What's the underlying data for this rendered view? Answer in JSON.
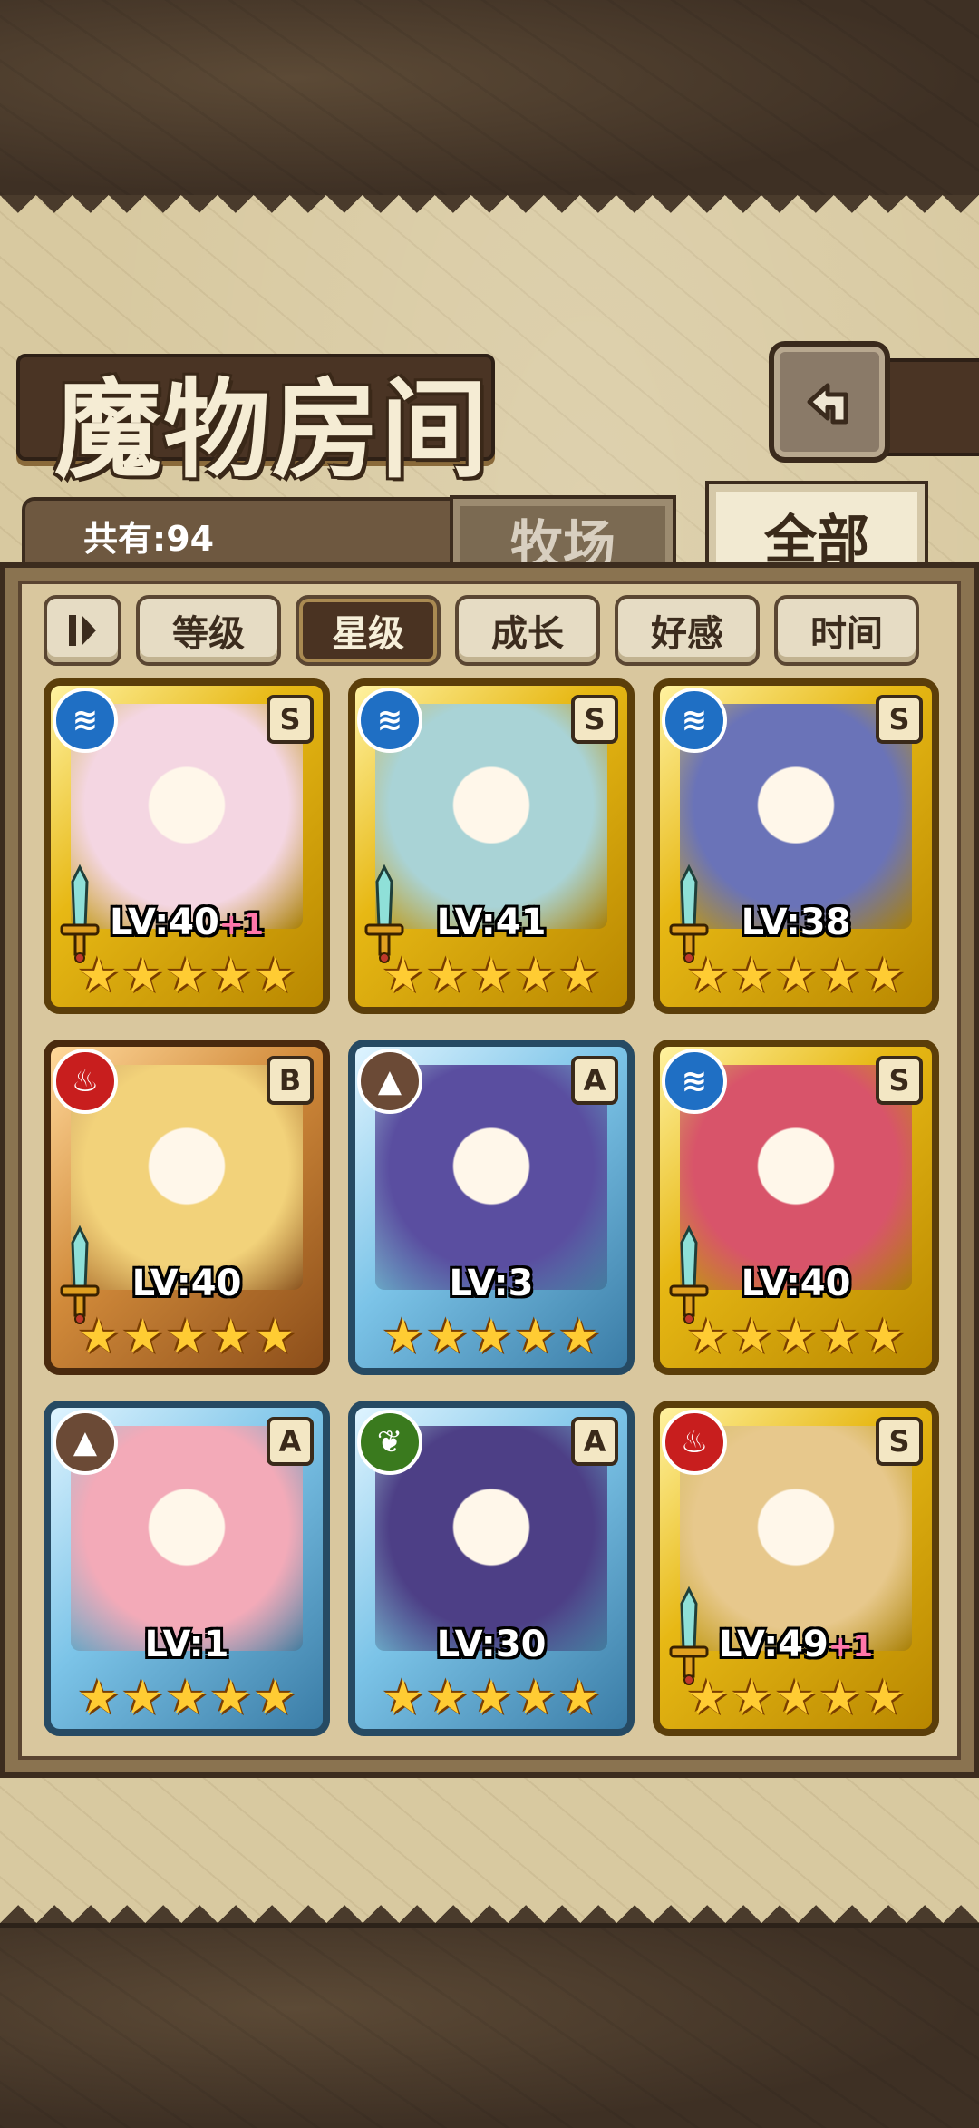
{
  "header": {
    "title": "魔物房间"
  },
  "count": {
    "label": "共有:94"
  },
  "tabs": [
    {
      "label": "牧场",
      "active": false
    },
    {
      "label": "全部",
      "active": true
    }
  ],
  "sort": [
    {
      "label": "等级",
      "active": false
    },
    {
      "label": "星级",
      "active": true
    },
    {
      "label": "成长",
      "active": false
    },
    {
      "label": "好感",
      "active": false
    },
    {
      "label": "时间",
      "active": false
    }
  ],
  "cards": [
    {
      "lv": "LV:40",
      "plus": "+1",
      "rank": "S",
      "element": "water",
      "frame": "gold",
      "stars": 5,
      "sword": true,
      "portrait_color": "#f4d6e2"
    },
    {
      "lv": "LV:41",
      "plus": "",
      "rank": "S",
      "element": "water",
      "frame": "gold",
      "stars": 5,
      "sword": true,
      "portrait_color": "#a9d3d6"
    },
    {
      "lv": "LV:38",
      "plus": "",
      "rank": "S",
      "element": "water",
      "frame": "gold",
      "stars": 5,
      "sword": true,
      "portrait_color": "#6a73b8"
    },
    {
      "lv": "LV:40",
      "plus": "",
      "rank": "B",
      "element": "fire",
      "frame": "bronze",
      "stars": 5,
      "sword": true,
      "portrait_color": "#f2d27a"
    },
    {
      "lv": "LV:3",
      "plus": "",
      "rank": "A",
      "element": "earth",
      "frame": "blue",
      "stars": 5,
      "sword": false,
      "portrait_color": "#5a4ea0"
    },
    {
      "lv": "LV:40",
      "plus": "",
      "rank": "S",
      "element": "water",
      "frame": "gold",
      "stars": 5,
      "sword": true,
      "portrait_color": "#d8546a"
    },
    {
      "lv": "LV:1",
      "plus": "",
      "rank": "A",
      "element": "earth",
      "frame": "blue",
      "stars": 5,
      "sword": false,
      "portrait_color": "#f3aab8"
    },
    {
      "lv": "LV:30",
      "plus": "",
      "rank": "A",
      "element": "leaf",
      "frame": "blue",
      "stars": 5,
      "sword": false,
      "portrait_color": "#4d3f86"
    },
    {
      "lv": "LV:49",
      "plus": "+1",
      "rank": "S",
      "element": "fire",
      "frame": "gold",
      "stars": 5,
      "sword": true,
      "portrait_color": "#e7c88c"
    }
  ]
}
